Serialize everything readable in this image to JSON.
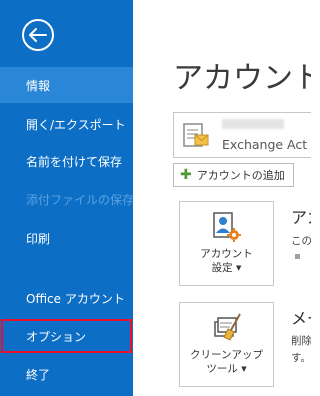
{
  "sidebar": {
    "items": [
      {
        "label": "情報",
        "state": "active"
      },
      {
        "label": "開く/エクスポート",
        "state": "normal"
      },
      {
        "label": "名前を付けて保存",
        "state": "normal"
      },
      {
        "label": "添付ファイルの保存",
        "state": "disabled"
      },
      {
        "label": "印刷",
        "state": "normal"
      },
      {
        "label": "Office アカウント",
        "state": "normal"
      },
      {
        "label": "オプション",
        "state": "highlighted"
      },
      {
        "label": "終了",
        "state": "normal"
      }
    ]
  },
  "main": {
    "title": "アカウント情",
    "account": {
      "type": "Exchange Act"
    },
    "add_account_label": "アカウントの追加",
    "tiles": [
      {
        "line1": "アカウント",
        "line2": "設定",
        "heading": "アカ",
        "description": "この"
      },
      {
        "line1": "クリーンアップ",
        "line2": "ツール",
        "heading": "メー",
        "description": "削除"
      }
    ],
    "extra_line": "す。"
  },
  "colors": {
    "sidebar_bg": "#0d6ec6",
    "active_bg": "#2a86d6",
    "highlight_border": "#e8102e",
    "plus_green": "#4f9a38"
  },
  "icons": {
    "back": "back-arrow-icon",
    "account_box": "account-mailbox-icon",
    "add": "plus-icon",
    "tile1": "account-settings-icon",
    "tile2": "cleanup-tools-icon"
  }
}
